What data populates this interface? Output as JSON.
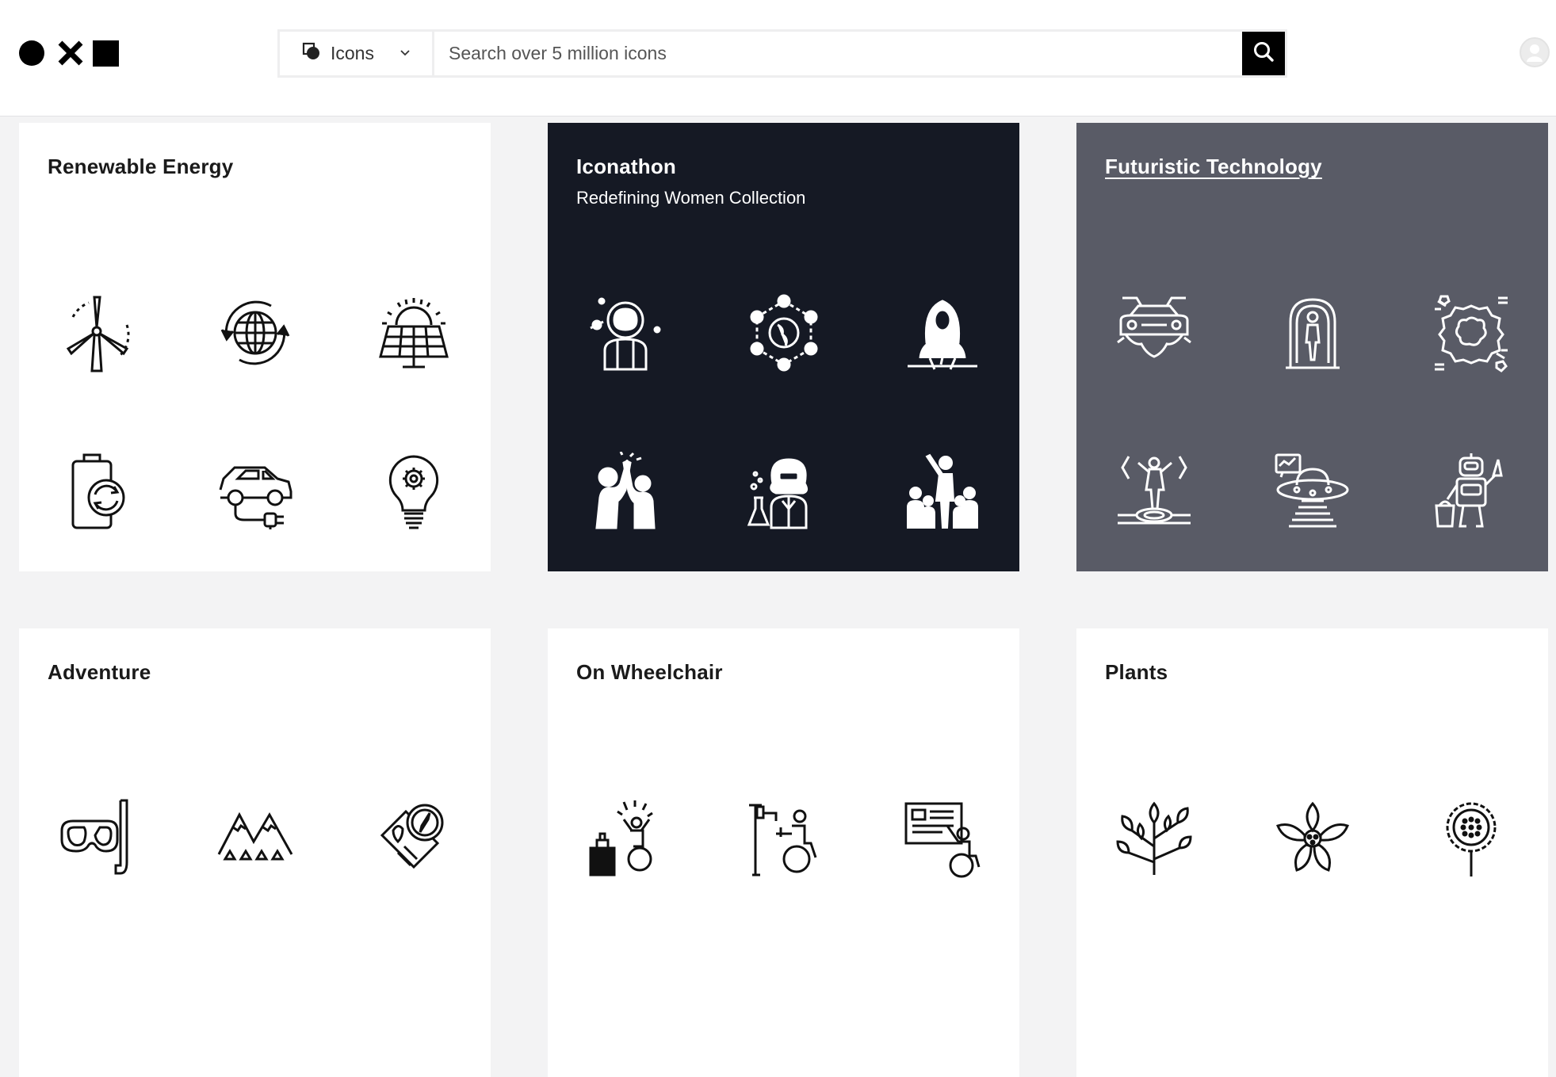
{
  "header": {
    "logo": {
      "name": "logo-icon",
      "shapes": [
        "circle",
        "cross",
        "square"
      ]
    },
    "search": {
      "type_label": "Icons",
      "placeholder": "Search over 5 million icons",
      "value": ""
    },
    "avatar_icon": "user-avatar-icon"
  },
  "collections": [
    {
      "title": "Renewable Energy",
      "subtitle": "",
      "theme": "light",
      "icons": [
        "wind-turbine-icon",
        "globe-recycle-icon",
        "solar-panel-icon",
        "battery-recharge-icon",
        "electric-car-icon",
        "light-bulb-gear-icon"
      ]
    },
    {
      "title": "Iconathon",
      "subtitle": "Redefining Women Collection",
      "theme": "dark",
      "icons": [
        "astronaut-woman-icon",
        "global-network-icon",
        "hijab-woman-writing-icon",
        "high-five-icon",
        "woman-scientist-icon",
        "woman-leader-group-icon"
      ]
    },
    {
      "title": "Futuristic Technology",
      "subtitle": "",
      "theme": "grey",
      "icons": [
        "flying-car-icon",
        "cryo-pod-icon",
        "ai-brain-chip-icon",
        "hologram-person-icon",
        "ufo-icon",
        "robot-cleaner-icon"
      ]
    },
    {
      "title": "Adventure",
      "subtitle": "",
      "theme": "light",
      "icons": [
        "snorkel-mask-icon",
        "mountains-icon",
        "map-compass-icon"
      ]
    },
    {
      "title": "On Wheelchair",
      "subtitle": "",
      "theme": "light",
      "icons": [
        "wheelchair-celebrate-icon",
        "wheelchair-iv-icon",
        "wheelchair-presentation-icon"
      ]
    },
    {
      "title": "Plants",
      "subtitle": "",
      "theme": "light",
      "icons": [
        "leafy-plant-icon",
        "flower-icon",
        "sunflower-icon"
      ]
    }
  ],
  "colors": {
    "dark_card": "#151924",
    "grey_card": "#595b66",
    "page_bg": "#f3f3f4"
  }
}
